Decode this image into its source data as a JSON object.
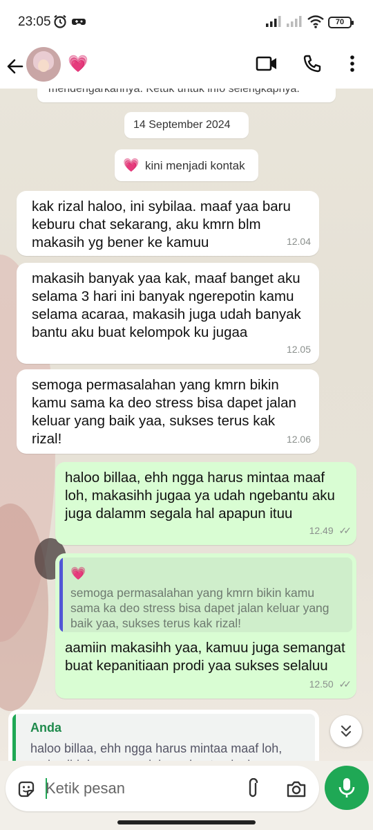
{
  "status_bar": {
    "time": "23:05",
    "battery": "70"
  },
  "header": {
    "contact_emoji": "💗"
  },
  "chat": {
    "top_notice": "mendengarkannya. Ketuk untuk info selengkapnya.",
    "date": "14 September 2024",
    "system_emoji": "💗",
    "system_text": "kini menjadi kontak",
    "messages": [
      {
        "text": "kak rizal haloo, ini sybilaa. maaf yaa baru keburu chat sekarang, aku kmrn blm makasih yg bener ke kamuu",
        "time": "12.04"
      },
      {
        "text": "makasih banyak yaa kak, maaf banget aku selama 3 hari ini banyak ngerepotin kamu selama acaraa, makasih juga udah banyak bantu aku buat kelompok ku jugaa",
        "time": "12.05"
      },
      {
        "text": "semoga permasalahan yang kmrn bikin kamu sama ka deo stress bisa dapet jalan keluar yang baik yaa, sukses terus kak rizal!",
        "time": "12.06"
      },
      {
        "text": "haloo billaa, ehh ngga harus mintaa maaf loh, makasihh jugaa ya udah ngebantu aku juga dalamm segala hal apapun ituu",
        "time": "12.49",
        "ticks": "✓✓"
      },
      {
        "quote_sender": "💗",
        "quote_text": "semoga permasalahan yang kmrn bikin kamu sama ka deo stress bisa dapet jalan keluar yang baik yaa, sukses terus kak rizal!",
        "text": "aamiin makasihh yaa, kamuu juga semangat buat kepanitiaan prodi yaa sukses selaluu",
        "time": "12.50",
        "ticks": "✓✓"
      }
    ],
    "reply_preview": {
      "sender": "Anda",
      "text": "haloo billaa, ehh ngga harus mintaa maaf loh, makasihh jugaa ya udah ngebantu aku juga"
    }
  },
  "input": {
    "placeholder": "Ketik pesan"
  },
  "icons": {
    "back": "back-arrow-icon",
    "video": "video-call-icon",
    "call": "phone-call-icon",
    "menu": "more-vert-icon",
    "sticker": "sticker-icon",
    "attach": "paperclip-icon",
    "camera": "camera-icon",
    "mic": "mic-icon",
    "scroll": "scroll-down-icon"
  },
  "colors": {
    "outgoing_bubble": "#d9fdd3",
    "incoming_bubble": "#ffffff",
    "accent": "#1fa855",
    "quote_bar": "#5157d6"
  }
}
